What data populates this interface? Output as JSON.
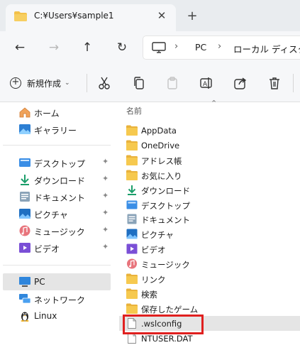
{
  "window": {
    "tab_title": "C:¥Users¥sample1",
    "close_glyph": "✕",
    "new_tab_glyph": "+"
  },
  "nav": {
    "back": "←",
    "forward": "→",
    "up": "↑",
    "refresh": "↻",
    "breadcrumbs": [
      "PC",
      "ローカル ディスク"
    ],
    "separator": "›"
  },
  "toolbar": {
    "new_label": "新規作成",
    "new_chevron": "⌄",
    "tools": [
      "cut-icon",
      "copy-icon",
      "paste-icon",
      "rename-icon",
      "share-icon",
      "delete-icon"
    ]
  },
  "sidebar": {
    "quick": [
      {
        "label": "ホーム",
        "icon": "home-icon"
      },
      {
        "label": "ギャラリー",
        "icon": "gallery-icon"
      }
    ],
    "pinned": [
      {
        "label": "デスクトップ",
        "icon": "desktop-icon"
      },
      {
        "label": "ダウンロード",
        "icon": "download-icon"
      },
      {
        "label": "ドキュメント",
        "icon": "documents-icon"
      },
      {
        "label": "ピクチャ",
        "icon": "pictures-icon"
      },
      {
        "label": "ミュージック",
        "icon": "music-icon"
      },
      {
        "label": "ビデオ",
        "icon": "videos-icon"
      }
    ],
    "pin_glyph": "📌",
    "devices": [
      {
        "label": "PC",
        "icon": "pc-icon",
        "selected": true
      },
      {
        "label": "ネットワーク",
        "icon": "network-icon"
      },
      {
        "label": "Linux",
        "icon": "linux-icon"
      }
    ]
  },
  "content": {
    "column_name": "名前",
    "sort_glyph": "⌃",
    "files": [
      {
        "name": "AppData",
        "icon": "folder-icon"
      },
      {
        "name": "OneDrive",
        "icon": "folder-icon"
      },
      {
        "name": "アドレス帳",
        "icon": "folder-icon"
      },
      {
        "name": "お気に入り",
        "icon": "folder-icon"
      },
      {
        "name": "ダウンロード",
        "icon": "download-icon"
      },
      {
        "name": "デスクトップ",
        "icon": "desktop-icon"
      },
      {
        "name": "ドキュメント",
        "icon": "documents-icon"
      },
      {
        "name": "ピクチャ",
        "icon": "pictures-icon"
      },
      {
        "name": "ビデオ",
        "icon": "videos-icon"
      },
      {
        "name": "ミュージック",
        "icon": "music-icon"
      },
      {
        "name": "リンク",
        "icon": "folder-icon"
      },
      {
        "name": "検索",
        "icon": "folder-icon"
      },
      {
        "name": "保存したゲーム",
        "icon": "folder-icon"
      },
      {
        "name": ".wslconfig",
        "icon": "file-icon",
        "highlighted": true
      },
      {
        "name": "NTUSER.DAT",
        "icon": "file-icon"
      }
    ]
  },
  "colors": {
    "folder": "#f3c14a",
    "highlight_box": "#e0201f",
    "selection": "#e5e5e5"
  }
}
